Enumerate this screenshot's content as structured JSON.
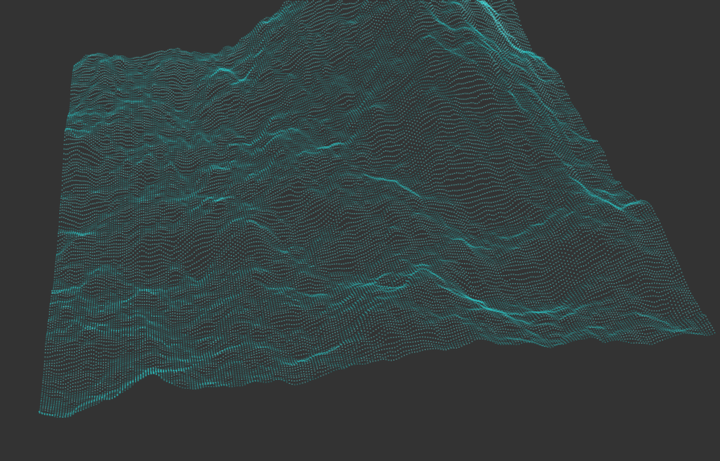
{
  "scene": {
    "background_color": "#333333",
    "point_color": "#2ee6e6",
    "highlight_color": "#5ff5f5",
    "render_style": "point-cloud",
    "subject": "terrain-heightmap"
  }
}
